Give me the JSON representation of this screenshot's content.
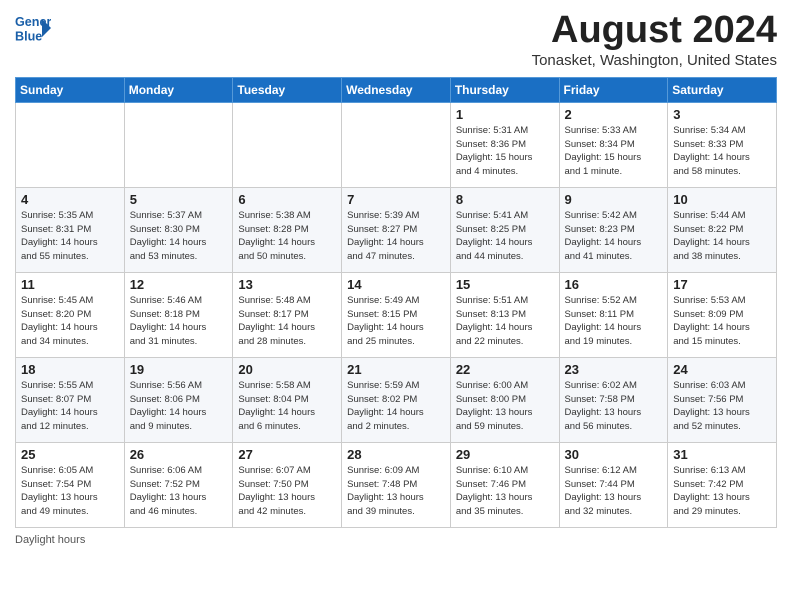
{
  "header": {
    "logo_line1": "General",
    "logo_line2": "Blue",
    "month_title": "August 2024",
    "subtitle": "Tonasket, Washington, United States"
  },
  "days_of_week": [
    "Sunday",
    "Monday",
    "Tuesday",
    "Wednesday",
    "Thursday",
    "Friday",
    "Saturday"
  ],
  "footer": {
    "daylight_label": "Daylight hours"
  },
  "weeks": [
    [
      {
        "num": "",
        "info": ""
      },
      {
        "num": "",
        "info": ""
      },
      {
        "num": "",
        "info": ""
      },
      {
        "num": "",
        "info": ""
      },
      {
        "num": "1",
        "info": "Sunrise: 5:31 AM\nSunset: 8:36 PM\nDaylight: 15 hours\nand 4 minutes."
      },
      {
        "num": "2",
        "info": "Sunrise: 5:33 AM\nSunset: 8:34 PM\nDaylight: 15 hours\nand 1 minute."
      },
      {
        "num": "3",
        "info": "Sunrise: 5:34 AM\nSunset: 8:33 PM\nDaylight: 14 hours\nand 58 minutes."
      }
    ],
    [
      {
        "num": "4",
        "info": "Sunrise: 5:35 AM\nSunset: 8:31 PM\nDaylight: 14 hours\nand 55 minutes."
      },
      {
        "num": "5",
        "info": "Sunrise: 5:37 AM\nSunset: 8:30 PM\nDaylight: 14 hours\nand 53 minutes."
      },
      {
        "num": "6",
        "info": "Sunrise: 5:38 AM\nSunset: 8:28 PM\nDaylight: 14 hours\nand 50 minutes."
      },
      {
        "num": "7",
        "info": "Sunrise: 5:39 AM\nSunset: 8:27 PM\nDaylight: 14 hours\nand 47 minutes."
      },
      {
        "num": "8",
        "info": "Sunrise: 5:41 AM\nSunset: 8:25 PM\nDaylight: 14 hours\nand 44 minutes."
      },
      {
        "num": "9",
        "info": "Sunrise: 5:42 AM\nSunset: 8:23 PM\nDaylight: 14 hours\nand 41 minutes."
      },
      {
        "num": "10",
        "info": "Sunrise: 5:44 AM\nSunset: 8:22 PM\nDaylight: 14 hours\nand 38 minutes."
      }
    ],
    [
      {
        "num": "11",
        "info": "Sunrise: 5:45 AM\nSunset: 8:20 PM\nDaylight: 14 hours\nand 34 minutes."
      },
      {
        "num": "12",
        "info": "Sunrise: 5:46 AM\nSunset: 8:18 PM\nDaylight: 14 hours\nand 31 minutes."
      },
      {
        "num": "13",
        "info": "Sunrise: 5:48 AM\nSunset: 8:17 PM\nDaylight: 14 hours\nand 28 minutes."
      },
      {
        "num": "14",
        "info": "Sunrise: 5:49 AM\nSunset: 8:15 PM\nDaylight: 14 hours\nand 25 minutes."
      },
      {
        "num": "15",
        "info": "Sunrise: 5:51 AM\nSunset: 8:13 PM\nDaylight: 14 hours\nand 22 minutes."
      },
      {
        "num": "16",
        "info": "Sunrise: 5:52 AM\nSunset: 8:11 PM\nDaylight: 14 hours\nand 19 minutes."
      },
      {
        "num": "17",
        "info": "Sunrise: 5:53 AM\nSunset: 8:09 PM\nDaylight: 14 hours\nand 15 minutes."
      }
    ],
    [
      {
        "num": "18",
        "info": "Sunrise: 5:55 AM\nSunset: 8:07 PM\nDaylight: 14 hours\nand 12 minutes."
      },
      {
        "num": "19",
        "info": "Sunrise: 5:56 AM\nSunset: 8:06 PM\nDaylight: 14 hours\nand 9 minutes."
      },
      {
        "num": "20",
        "info": "Sunrise: 5:58 AM\nSunset: 8:04 PM\nDaylight: 14 hours\nand 6 minutes."
      },
      {
        "num": "21",
        "info": "Sunrise: 5:59 AM\nSunset: 8:02 PM\nDaylight: 14 hours\nand 2 minutes."
      },
      {
        "num": "22",
        "info": "Sunrise: 6:00 AM\nSunset: 8:00 PM\nDaylight: 13 hours\nand 59 minutes."
      },
      {
        "num": "23",
        "info": "Sunrise: 6:02 AM\nSunset: 7:58 PM\nDaylight: 13 hours\nand 56 minutes."
      },
      {
        "num": "24",
        "info": "Sunrise: 6:03 AM\nSunset: 7:56 PM\nDaylight: 13 hours\nand 52 minutes."
      }
    ],
    [
      {
        "num": "25",
        "info": "Sunrise: 6:05 AM\nSunset: 7:54 PM\nDaylight: 13 hours\nand 49 minutes."
      },
      {
        "num": "26",
        "info": "Sunrise: 6:06 AM\nSunset: 7:52 PM\nDaylight: 13 hours\nand 46 minutes."
      },
      {
        "num": "27",
        "info": "Sunrise: 6:07 AM\nSunset: 7:50 PM\nDaylight: 13 hours\nand 42 minutes."
      },
      {
        "num": "28",
        "info": "Sunrise: 6:09 AM\nSunset: 7:48 PM\nDaylight: 13 hours\nand 39 minutes."
      },
      {
        "num": "29",
        "info": "Sunrise: 6:10 AM\nSunset: 7:46 PM\nDaylight: 13 hours\nand 35 minutes."
      },
      {
        "num": "30",
        "info": "Sunrise: 6:12 AM\nSunset: 7:44 PM\nDaylight: 13 hours\nand 32 minutes."
      },
      {
        "num": "31",
        "info": "Sunrise: 6:13 AM\nSunset: 7:42 PM\nDaylight: 13 hours\nand 29 minutes."
      }
    ]
  ]
}
